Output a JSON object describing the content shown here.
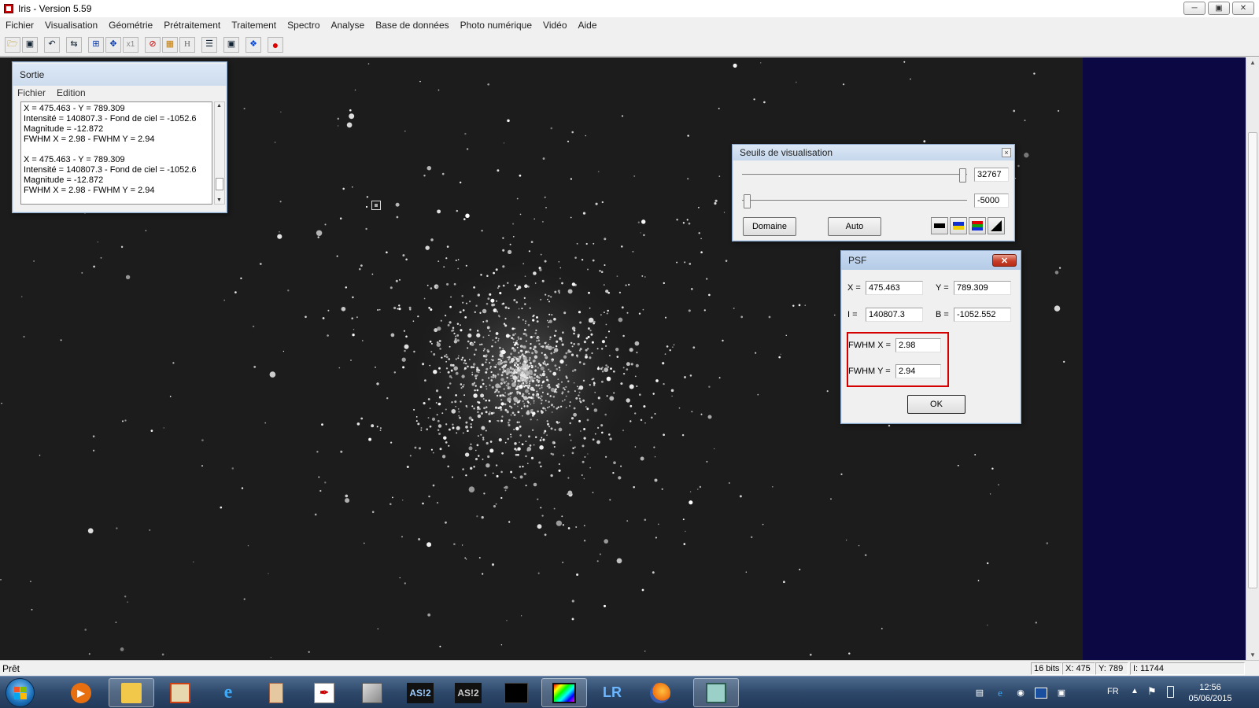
{
  "window": {
    "title": "Iris - Version 5.59",
    "controls": [
      "minimize-icon",
      "maximize-icon",
      "close-icon"
    ]
  },
  "menu": [
    "Fichier",
    "Visualisation",
    "Géométrie",
    "Prétraitement",
    "Traitement",
    "Spectro",
    "Analyse",
    "Base de données",
    "Photo numérique",
    "Vidéo",
    "Aide"
  ],
  "toolbar": {
    "icons": [
      "open-folder-icon",
      "save-icon",
      "undo-icon",
      "swap-icon",
      "zoom-in-icon",
      "move-icon",
      "x1-icon",
      "no-icon",
      "grid-icon",
      "histogram-icon",
      "list-icon",
      "camera-icon",
      "diamond-icon",
      "record-icon"
    ],
    "x1_label": "x1",
    "h_label": "H"
  },
  "sortie": {
    "title": "Sortie",
    "menu": [
      "Fichier",
      "Edition"
    ],
    "log": [
      "X = 475.463  -  Y = 789.309",
      "Intensité = 140807.3  -  Fond de ciel = -1052.6",
      "Magnitude = -12.872",
      "FWHM X = 2.98  -  FWHM Y = 2.94",
      "",
      "X = 475.463  -  Y = 789.309",
      "Intensité = 140807.3  -  Fond de ciel = -1052.6",
      "Magnitude = -12.872",
      "FWHM X = 2.98  -  FWHM Y = 2.94"
    ]
  },
  "seuils": {
    "title": "Seuils de visualisation",
    "high_value": "32767",
    "low_value": "-5000",
    "domaine_label": "Domaine",
    "auto_label": "Auto",
    "palette_buttons": [
      "grayscale-palette-icon",
      "blue-yellow-palette-icon",
      "rainbow-palette-icon",
      "gradient-palette-icon"
    ]
  },
  "psf": {
    "title": "PSF",
    "x_label": "X =",
    "x_value": "475.463",
    "y_label": "Y =",
    "y_value": "789.309",
    "i_label": "I =",
    "i_value": "140807.3",
    "b_label": "B =",
    "b_value": "-1052.552",
    "fwhm_x_label": "FWHM X =",
    "fwhm_x_value": "2.98",
    "fwhm_y_label": "FWHM Y =",
    "fwhm_y_value": "2.94",
    "ok_label": "OK"
  },
  "status": {
    "text": "Prêt",
    "bits": "16 bits",
    "x": "X: 475",
    "y": "Y: 789",
    "intensity": "I: 11744"
  },
  "taskbar": {
    "apps": [
      "media-player-icon",
      "file-explorer-icon",
      "paint-icon",
      "internet-explorer-icon",
      "app-icon",
      "pdf-icon",
      "box-icon",
      "asi2-icon",
      "asi2-alt-icon",
      "starfield-icon",
      "color-film-icon",
      "lightroom-icon",
      "firefox-icon",
      "iris-icon"
    ],
    "asi_label": "AS!2",
    "asi_label_alt": "AS!2",
    "lr_label": "LR",
    "language": "FR",
    "time": "12:56",
    "date": "05/06/2015"
  },
  "colors": {
    "sky": "#1c1c1c",
    "blue_strip": "#0b0844",
    "highlight": "#d40000"
  }
}
